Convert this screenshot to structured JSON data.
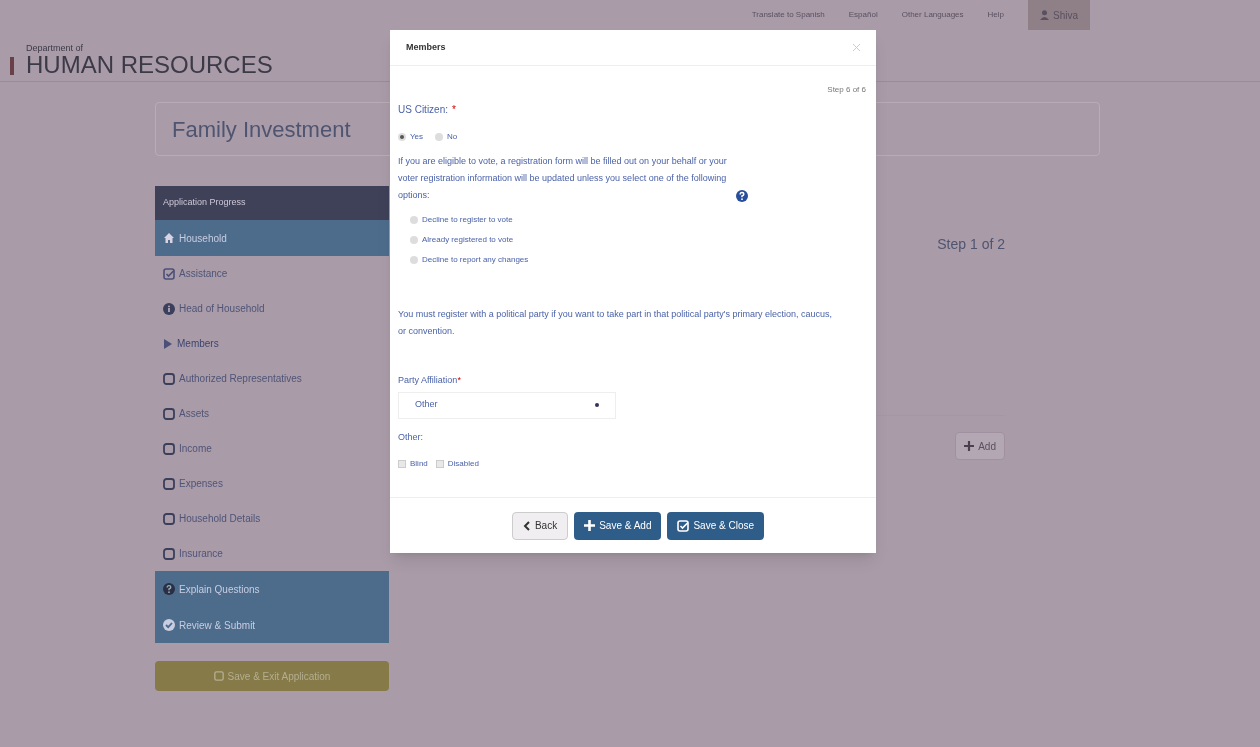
{
  "top_nav": {
    "links": [
      "Translate to Spanish",
      "Español",
      "Other Languages",
      "Help"
    ],
    "user": "Shiva"
  },
  "logo": {
    "small": "Department of",
    "large": "HUMAN RESOURCES"
  },
  "page_title": "Family Investment",
  "sidebar": {
    "header": "Application Progress",
    "items": [
      {
        "kind": "section",
        "label": "Household"
      },
      {
        "kind": "complete",
        "label": "Assistance"
      },
      {
        "kind": "info",
        "label": "Head of Household"
      },
      {
        "kind": "current",
        "label": "Members"
      },
      {
        "kind": "pending",
        "label": "Authorized Representatives"
      },
      {
        "kind": "pending",
        "label": "Assets"
      },
      {
        "kind": "pending",
        "label": "Income"
      },
      {
        "kind": "pending",
        "label": "Expenses"
      },
      {
        "kind": "pending",
        "label": "Household Details"
      },
      {
        "kind": "pending",
        "label": "Insurance"
      },
      {
        "kind": "section",
        "label": "Explain Questions"
      },
      {
        "kind": "section",
        "label": "Review & Submit"
      }
    ],
    "save_button": "Save & Exit Application"
  },
  "content": {
    "step": "Step 1 of 2",
    "add_button": "Add"
  },
  "modal": {
    "title": "Members",
    "step": "Step 6 of 6",
    "citizen": {
      "label": "US Citizen:",
      "required_mark": "*",
      "options": [
        {
          "label": "Yes",
          "selected": true
        },
        {
          "label": "No",
          "selected": false
        }
      ]
    },
    "voter_note": "If you are eligible to vote, a registration form will be  filled out on your behalf or your voter registration information will be updated unless you select one of the following options:",
    "voter_options": [
      {
        "label": "Decline to register to vote",
        "selected": false
      },
      {
        "label": "Already registered to vote",
        "selected": false
      },
      {
        "label": "Decline to report any changes",
        "selected": false
      }
    ],
    "party_note": "You must register with a political party if you want to take part in that political party's primary election, caucus, or convention.",
    "party": {
      "label": "Party Affiliation",
      "required_mark": "*",
      "value": "Other"
    },
    "other_label": "Other:",
    "other_checks": [
      {
        "label": "Blind",
        "checked": false
      },
      {
        "label": "Disabled",
        "checked": false
      }
    ],
    "buttons": [
      {
        "kind": "back",
        "label": "Back"
      },
      {
        "kind": "add",
        "label": "Save & Add"
      },
      {
        "kind": "close",
        "label": "Save & Close"
      }
    ]
  }
}
